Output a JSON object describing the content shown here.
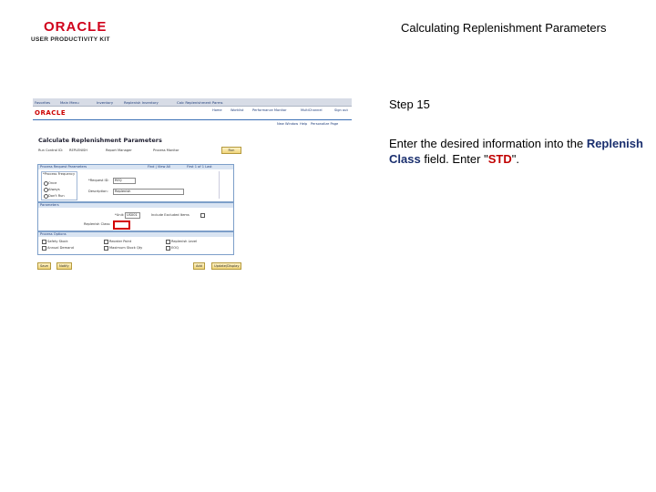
{
  "header": {
    "logo_brand": "ORACLE",
    "logo_product": "USER PRODUCTIVITY KIT",
    "title": "Calculating Replenishment Parameters"
  },
  "screenshot": {
    "menu_items": [
      "Favorites",
      "Main Menu",
      "Inventory",
      "Replenish Inventory",
      "Calc Replenishment Parms"
    ],
    "brand": "ORACLE",
    "top_links": [
      "Home",
      "Worklist",
      "Performance Monitor",
      "MultiChannel",
      "Sign out"
    ],
    "sub_links": [
      "New Window",
      "Help",
      "Personalize Page"
    ],
    "page_title": "Calculate Replenishment Parameters",
    "run_control_label": "Run Control ID:",
    "run_control_value": "REPLENISH",
    "report_manager_link": "Report Manager",
    "process_monitor_link": "Process Monitor",
    "run_button": "Run",
    "request_section": "Process Request Parameters",
    "request_nav": "Find | View All",
    "request_pager": "First  1 of 1  Last",
    "freq_label": "*Process Frequency",
    "freq_options": [
      "Once",
      "Always",
      "Don't Run"
    ],
    "request_id_label": "*Request ID:",
    "request_id_value": "REQ",
    "description_label": "Description:",
    "description_value": "Replenish",
    "params_section": "Parameters",
    "unit_label": "*Unit:",
    "unit_value": "US001",
    "include_label": "Include Excluded Items",
    "replenish_class_label": "Replenish Class:",
    "options_section": "Process Options",
    "options": [
      "Safety Stock",
      "Reorder Point",
      "Replenish Level",
      "Annual Demand",
      "Maximum Stock Qty",
      "EOQ"
    ],
    "save_button": "Save",
    "notify_button": "Notify",
    "add_button": "Add",
    "update_button": "Update/Display"
  },
  "instruction": {
    "step": "Step 15",
    "text_before": "Enter the desired information into the",
    "field_name": "Replenish Class",
    "text_middle": "field. Enter \"",
    "value": "STD",
    "text_after": "\"."
  },
  "colors": {
    "highlight": "#d40000",
    "field_name": "#1a2f6e",
    "value": "#c00000"
  }
}
